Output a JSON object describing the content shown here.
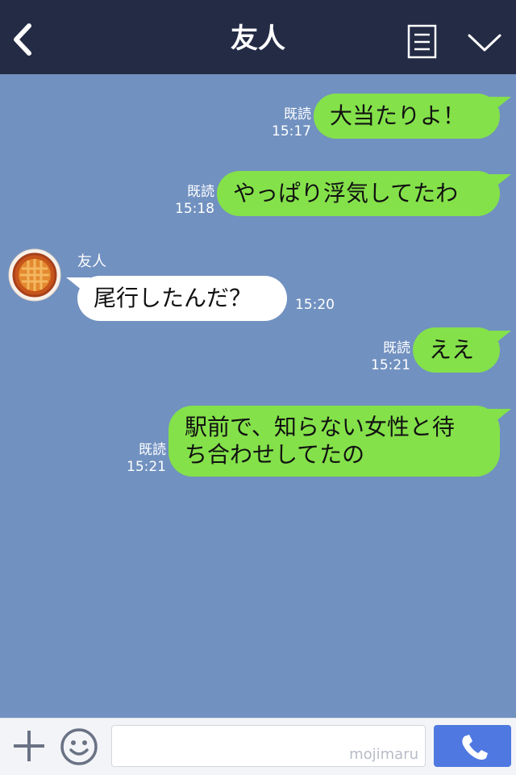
{
  "header": {
    "title": "友人",
    "back_icon": "chevron-left-icon",
    "menu_icon": "note-icon",
    "dropdown_icon": "chevron-down-icon"
  },
  "chat": {
    "read_label": "既読",
    "sender_name": "友人",
    "messages": [
      {
        "from": "me",
        "text": "大当たりよ！",
        "time": "15:17",
        "read": true
      },
      {
        "from": "me",
        "text": "やっぱり浮気してたわ",
        "time": "15:18",
        "read": true
      },
      {
        "from": "them",
        "text": "尾行したんだ？",
        "time": "15:20"
      },
      {
        "from": "me",
        "text": "ええ",
        "time": "15:21",
        "read": true
      },
      {
        "from": "me",
        "lines": [
          "駅前で、知らない女性と待",
          "ち合わせしてたの"
        ],
        "time": "15:21",
        "read": true
      }
    ]
  },
  "footer": {
    "input_value": "",
    "watermark": "mojimaru",
    "plus_icon": "plus-icon",
    "emoji_icon": "smiley-icon",
    "call_icon": "phone-icon"
  },
  "colors": {
    "header_bg": "#232b45",
    "chat_bg": "#7191c0",
    "my_bubble": "#84e14a",
    "their_bubble": "#ffffff",
    "call_button": "#4f79e1"
  }
}
